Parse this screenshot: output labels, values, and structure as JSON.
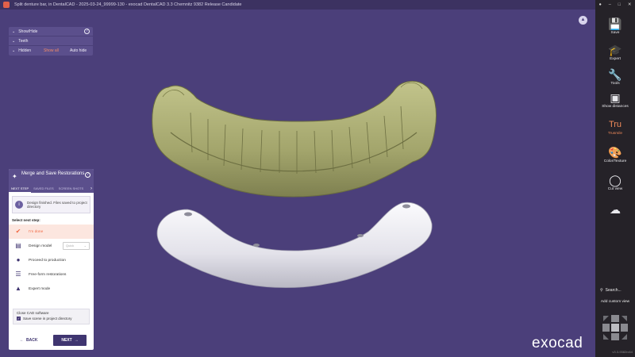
{
  "window": {
    "title": "Split denture bar, in DentalCAD - 2025-03-24_99999-130 - exocad DentalCAD 3.3 Chemnitz 9382 Release Candidate",
    "min": "–",
    "max": "□",
    "close": "✕"
  },
  "showhide": {
    "title": "Show/Hide",
    "teeth": "Teeth",
    "hidden": "Hidden",
    "show_all": "Show all",
    "auto_hide": "Auto hide",
    "help": "?"
  },
  "bell_glyph": "▲",
  "logo": "exocad",
  "wizard": {
    "title": "Merge and Save Restorations",
    "help": "?",
    "tabs": [
      "NEXT STEP",
      "SAVED FILES",
      "SCREEN SHOTS"
    ],
    "info": "Design finished. Files saved to project directory",
    "select_label": "Select next step:",
    "options": [
      {
        "label": "I'm done",
        "icon": "checkmark-icon",
        "selected": true
      },
      {
        "label": "Design model",
        "icon": "model-icon",
        "dropdown": "Quick"
      },
      {
        "label": "Proceed to production",
        "icon": "production-icon"
      },
      {
        "label": "Free-form restorations",
        "icon": "freeform-icon"
      },
      {
        "label": "Expert mode",
        "icon": "graduation-cap-icon"
      }
    ],
    "close_cad": "Close CAD software",
    "save_scene": "Save scene in project directory",
    "back": "BACK",
    "next": "NEXT"
  },
  "toolbar": {
    "items": [
      {
        "label": "Save",
        "icon": "save-icon"
      },
      {
        "label": "Expert",
        "icon": "graduation-cap-icon"
      },
      {
        "label": "Tools",
        "icon": "tools-icon"
      },
      {
        "label": "Show distances",
        "icon": "distances-icon"
      },
      {
        "label": "Trusmile",
        "icon": "trusmile-icon",
        "accent": true
      },
      {
        "label": "Color/Texture",
        "icon": "palette-icon"
      },
      {
        "label": "Cut view",
        "icon": "cut-view-icon"
      },
      {
        "label": "",
        "icon": "add-cloud-icon"
      }
    ],
    "search": "Search...",
    "custom_view": "Add custom view",
    "version": "v3.3-9382rc64"
  },
  "colors": {
    "background": "#4b3f7a",
    "accent": "#f26a45",
    "panel": "#5b4f8c",
    "toolbar": "#252228",
    "teeth": "#a9ab72"
  }
}
